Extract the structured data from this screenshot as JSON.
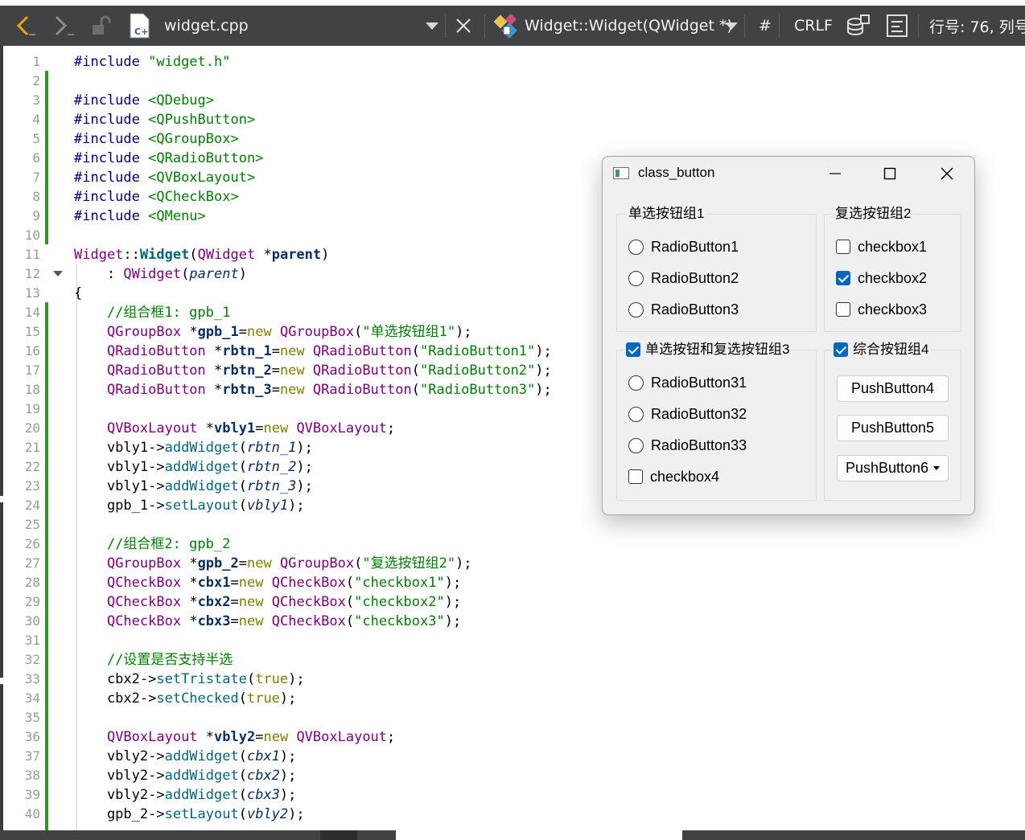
{
  "toolbar": {
    "file_name": "widget.cpp",
    "symbol": "Widget::Widget(QWidget *)",
    "hash": "#",
    "line_ending": "CRLF",
    "position": "行号: 76, 列号:"
  },
  "editor": {
    "line_numbers": [
      "1",
      "2",
      "3",
      "4",
      "5",
      "6",
      "7",
      "8",
      "9",
      "10",
      "11",
      "12",
      "13",
      "14",
      "15",
      "16",
      "17",
      "18",
      "19",
      "20",
      "21",
      "22",
      "23",
      "24",
      "25",
      "26",
      "27",
      "28",
      "29",
      "30",
      "31",
      "32",
      "33",
      "34",
      "35",
      "36",
      "37",
      "38",
      "39",
      "40"
    ],
    "lines": [
      [
        [
          "pre",
          "#include "
        ],
        [
          "str",
          "\"widget.h\""
        ]
      ],
      [],
      [
        [
          "pre",
          "#include "
        ],
        [
          "str",
          "<QDebug>"
        ]
      ],
      [
        [
          "pre",
          "#include "
        ],
        [
          "str",
          "<QPushButton>"
        ]
      ],
      [
        [
          "pre",
          "#include "
        ],
        [
          "str",
          "<QGroupBox>"
        ]
      ],
      [
        [
          "pre",
          "#include "
        ],
        [
          "str",
          "<QRadioButton>"
        ]
      ],
      [
        [
          "pre",
          "#include "
        ],
        [
          "str",
          "<QVBoxLayout>"
        ]
      ],
      [
        [
          "pre",
          "#include "
        ],
        [
          "str",
          "<QCheckBox>"
        ]
      ],
      [
        [
          "pre",
          "#include "
        ],
        [
          "str",
          "<QMenu>"
        ]
      ],
      [],
      [
        [
          "type",
          "Widget"
        ],
        [
          "plain",
          "::"
        ],
        [
          "fnb",
          "Widget"
        ],
        [
          "plain",
          "("
        ],
        [
          "type",
          "QWidget"
        ],
        [
          "plain",
          " *"
        ],
        [
          "var",
          "parent"
        ],
        [
          "plain",
          ")"
        ]
      ],
      [
        [
          "plain",
          "    : "
        ],
        [
          "type",
          "QWidget"
        ],
        [
          "plain",
          "("
        ],
        [
          "ital",
          "parent"
        ],
        [
          "plain",
          ")"
        ]
      ],
      [
        [
          "plain",
          "{"
        ]
      ],
      [
        [
          "plain",
          "    "
        ],
        [
          "com",
          "//组合框1: gpb_1"
        ]
      ],
      [
        [
          "plain",
          "    "
        ],
        [
          "type",
          "QGroupBox"
        ],
        [
          "plain",
          " *"
        ],
        [
          "var",
          "gpb_1"
        ],
        [
          "plain",
          "="
        ],
        [
          "kw",
          "new"
        ],
        [
          "plain",
          " "
        ],
        [
          "type",
          "QGroupBox"
        ],
        [
          "plain",
          "("
        ],
        [
          "str",
          "\"单选按钮组1\""
        ],
        [
          "plain",
          ");"
        ]
      ],
      [
        [
          "plain",
          "    "
        ],
        [
          "type",
          "QRadioButton"
        ],
        [
          "plain",
          " *"
        ],
        [
          "var",
          "rbtn_1"
        ],
        [
          "plain",
          "="
        ],
        [
          "kw",
          "new"
        ],
        [
          "plain",
          " "
        ],
        [
          "type",
          "QRadioButton"
        ],
        [
          "plain",
          "("
        ],
        [
          "str",
          "\"RadioButton1\""
        ],
        [
          "plain",
          ");"
        ]
      ],
      [
        [
          "plain",
          "    "
        ],
        [
          "type",
          "QRadioButton"
        ],
        [
          "plain",
          " *"
        ],
        [
          "var",
          "rbtn_2"
        ],
        [
          "plain",
          "="
        ],
        [
          "kw",
          "new"
        ],
        [
          "plain",
          " "
        ],
        [
          "type",
          "QRadioButton"
        ],
        [
          "plain",
          "("
        ],
        [
          "str",
          "\"RadioButton2\""
        ],
        [
          "plain",
          ");"
        ]
      ],
      [
        [
          "plain",
          "    "
        ],
        [
          "type",
          "QRadioButton"
        ],
        [
          "plain",
          " *"
        ],
        [
          "var",
          "rbtn_3"
        ],
        [
          "plain",
          "="
        ],
        [
          "kw",
          "new"
        ],
        [
          "plain",
          " "
        ],
        [
          "type",
          "QRadioButton"
        ],
        [
          "plain",
          "("
        ],
        [
          "str",
          "\"RadioButton3\""
        ],
        [
          "plain",
          ");"
        ]
      ],
      [],
      [
        [
          "plain",
          "    "
        ],
        [
          "type",
          "QVBoxLayout"
        ],
        [
          "plain",
          " *"
        ],
        [
          "var",
          "vbly1"
        ],
        [
          "plain",
          "="
        ],
        [
          "kw",
          "new"
        ],
        [
          "plain",
          " "
        ],
        [
          "type",
          "QVBoxLayout"
        ],
        [
          "plain",
          ";"
        ]
      ],
      [
        [
          "plain",
          "    vbly1->"
        ],
        [
          "fn",
          "addWidget"
        ],
        [
          "plain",
          "("
        ],
        [
          "ital",
          "rbtn_1"
        ],
        [
          "plain",
          ");"
        ]
      ],
      [
        [
          "plain",
          "    vbly1->"
        ],
        [
          "fn",
          "addWidget"
        ],
        [
          "plain",
          "("
        ],
        [
          "ital",
          "rbtn_2"
        ],
        [
          "plain",
          ");"
        ]
      ],
      [
        [
          "plain",
          "    vbly1->"
        ],
        [
          "fn",
          "addWidget"
        ],
        [
          "plain",
          "("
        ],
        [
          "ital",
          "rbtn_3"
        ],
        [
          "plain",
          ");"
        ]
      ],
      [
        [
          "plain",
          "    gpb_1->"
        ],
        [
          "fn",
          "setLayout"
        ],
        [
          "plain",
          "("
        ],
        [
          "ital",
          "vbly1"
        ],
        [
          "plain",
          ");"
        ]
      ],
      [],
      [
        [
          "plain",
          "    "
        ],
        [
          "com",
          "//组合框2: gpb_2"
        ]
      ],
      [
        [
          "plain",
          "    "
        ],
        [
          "type",
          "QGroupBox"
        ],
        [
          "plain",
          " *"
        ],
        [
          "var",
          "gpb_2"
        ],
        [
          "plain",
          "="
        ],
        [
          "kw",
          "new"
        ],
        [
          "plain",
          " "
        ],
        [
          "type",
          "QGroupBox"
        ],
        [
          "plain",
          "("
        ],
        [
          "str",
          "\"复选按钮组2\""
        ],
        [
          "plain",
          ");"
        ]
      ],
      [
        [
          "plain",
          "    "
        ],
        [
          "type",
          "QCheckBox"
        ],
        [
          "plain",
          " *"
        ],
        [
          "var",
          "cbx1"
        ],
        [
          "plain",
          "="
        ],
        [
          "kw",
          "new"
        ],
        [
          "plain",
          " "
        ],
        [
          "type",
          "QCheckBox"
        ],
        [
          "plain",
          "("
        ],
        [
          "str",
          "\"checkbox1\""
        ],
        [
          "plain",
          ");"
        ]
      ],
      [
        [
          "plain",
          "    "
        ],
        [
          "type",
          "QCheckBox"
        ],
        [
          "plain",
          " *"
        ],
        [
          "var",
          "cbx2"
        ],
        [
          "plain",
          "="
        ],
        [
          "kw",
          "new"
        ],
        [
          "plain",
          " "
        ],
        [
          "type",
          "QCheckBox"
        ],
        [
          "plain",
          "("
        ],
        [
          "str",
          "\"checkbox2\""
        ],
        [
          "plain",
          ");"
        ]
      ],
      [
        [
          "plain",
          "    "
        ],
        [
          "type",
          "QCheckBox"
        ],
        [
          "plain",
          " *"
        ],
        [
          "var",
          "cbx3"
        ],
        [
          "plain",
          "="
        ],
        [
          "kw",
          "new"
        ],
        [
          "plain",
          " "
        ],
        [
          "type",
          "QCheckBox"
        ],
        [
          "plain",
          "("
        ],
        [
          "str",
          "\"checkbox3\""
        ],
        [
          "plain",
          ");"
        ]
      ],
      [],
      [
        [
          "plain",
          "    "
        ],
        [
          "com",
          "//设置是否支持半选"
        ]
      ],
      [
        [
          "plain",
          "    cbx2->"
        ],
        [
          "fn",
          "setTristate"
        ],
        [
          "plain",
          "("
        ],
        [
          "kw",
          "true"
        ],
        [
          "plain",
          ");"
        ]
      ],
      [
        [
          "plain",
          "    cbx2->"
        ],
        [
          "fn",
          "setChecked"
        ],
        [
          "plain",
          "("
        ],
        [
          "kw",
          "true"
        ],
        [
          "plain",
          ");"
        ]
      ],
      [],
      [
        [
          "plain",
          "    "
        ],
        [
          "type",
          "QVBoxLayout"
        ],
        [
          "plain",
          " *"
        ],
        [
          "var",
          "vbly2"
        ],
        [
          "plain",
          "="
        ],
        [
          "kw",
          "new"
        ],
        [
          "plain",
          " "
        ],
        [
          "type",
          "QVBoxLayout"
        ],
        [
          "plain",
          ";"
        ]
      ],
      [
        [
          "plain",
          "    vbly2->"
        ],
        [
          "fn",
          "addWidget"
        ],
        [
          "plain",
          "("
        ],
        [
          "ital",
          "cbx1"
        ],
        [
          "plain",
          ");"
        ]
      ],
      [
        [
          "plain",
          "    vbly2->"
        ],
        [
          "fn",
          "addWidget"
        ],
        [
          "plain",
          "("
        ],
        [
          "ital",
          "cbx2"
        ],
        [
          "plain",
          ");"
        ]
      ],
      [
        [
          "plain",
          "    vbly2->"
        ],
        [
          "fn",
          "addWidget"
        ],
        [
          "plain",
          "("
        ],
        [
          "ital",
          "cbx3"
        ],
        [
          "plain",
          ");"
        ]
      ],
      [
        [
          "plain",
          "    gpb_2->"
        ],
        [
          "fn",
          "setLayout"
        ],
        [
          "plain",
          "("
        ],
        [
          "ital",
          "vbly2"
        ],
        [
          "plain",
          ");"
        ]
      ]
    ]
  },
  "window": {
    "title": "class_button",
    "group1": {
      "title": "单选按钮组1",
      "options": [
        "RadioButton1",
        "RadioButton2",
        "RadioButton3"
      ]
    },
    "group2": {
      "title": "复选按钮组2",
      "options": [
        "checkbox1",
        "checkbox2",
        "checkbox3"
      ],
      "checked": [
        false,
        true,
        false
      ]
    },
    "group3": {
      "title": "单选按钮和复选按钮组3",
      "checked": true,
      "radios": [
        "RadioButton31",
        "RadioButton32",
        "RadioButton33"
      ],
      "checkbox": "checkbox4"
    },
    "group4": {
      "title": "综合按钮组4",
      "checked": true,
      "buttons": [
        "PushButton4",
        "PushButton5",
        "PushButton6"
      ]
    }
  },
  "colors": {
    "toolbar_bg": "#404244",
    "accent": "#0067c0",
    "change_bar": "#2b9a1c",
    "string": "#008000",
    "type": "#800080",
    "keyword": "#808000"
  }
}
